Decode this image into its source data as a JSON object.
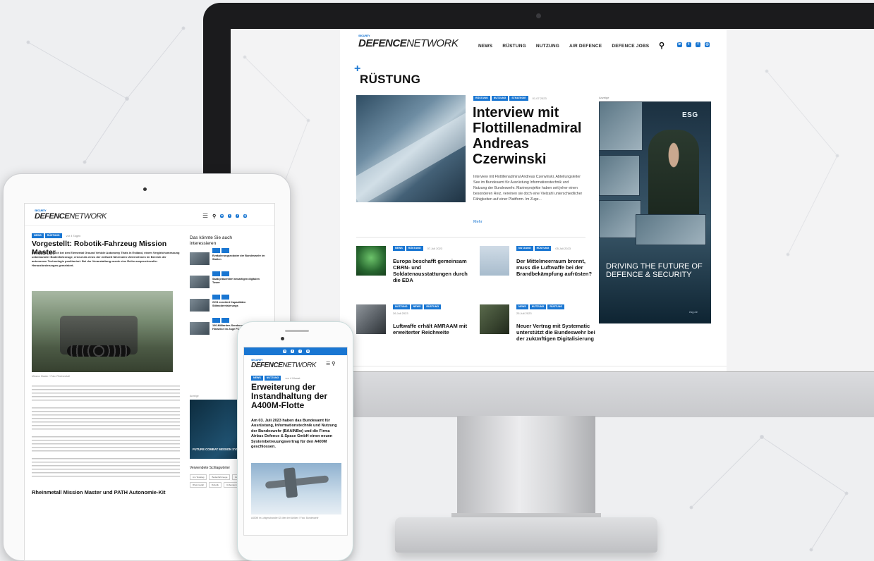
{
  "site": {
    "logo_bold": "DEFENCE",
    "logo_light": "NETWORK",
    "logo_sup": "SECURITY"
  },
  "desktop": {
    "nav": [
      "NEWS",
      "RÜSTUNG",
      "NUTZUNG",
      "AIR DEFENCE",
      "DEFENCE JOBS"
    ],
    "section": "RÜSTUNG",
    "hero": {
      "tags": [
        "RÜSTUNG",
        "NUTZUNG",
        "STRATEGIE"
      ],
      "date": "01.07.2023",
      "title": "Interview mit Flottillenadmiral Andreas Czerwinski",
      "excerpt": "Interview mit Flottillenadmiral Andreas Czerwinski, Abteilungsleiter See im Bundesamt für Ausrüstung Informationstechnik und Nutzung der Bundeswehr. Marineprojekte haben seit jeher einen besonderen Reiz, vereinen sie doch eine Vielzahl unterschiedlicher Fähigkeiten auf einer Plattform. Im Zuge...",
      "more": "Mehr"
    },
    "ad": {
      "label": "Anzeige",
      "brand": "ESG",
      "copy": "DRIVING THE FUTURE OF DEFENCE & SECURITY",
      "url": "esg.de"
    },
    "cards": [
      {
        "tags": [
          "NEWS",
          "RÜSTUNG"
        ],
        "date": "07.Juli 2023",
        "title": "Europa beschafft gemeinsam CBRN- und Soldatenausstattungen durch die EDA"
      },
      {
        "tags": [
          "NUTZUNG",
          "RÜSTUNG"
        ],
        "date": "05.Juli 2023",
        "title": "Der Mittelmeerraum brennt, muss die Luftwaffe bei der Brandbekämpfung aufrüsten?"
      },
      {
        "tags": [
          "NUTZUNG",
          "NEWS",
          "RÜSTUNG"
        ],
        "date": "26.Juli 2023",
        "title": "Luftwaffe erhält AMRAAM mit erweiterter Reichweite"
      },
      {
        "tags": [
          "NEWS",
          "NUTZUNG",
          "RÜSTUNG"
        ],
        "date": "25.Juli 2023",
        "title": "Neuer Vertrag mit Systematic unterstützt die Bundeswehr bei der zukünftigen Digitalisierung"
      }
    ]
  },
  "tablet": {
    "tags": [
      "NEWS",
      "RÜSTUNG"
    ],
    "date": "vor 4 Tagen",
    "title": "Vorgestellt: Robotik-Fahrzeug Mission Master",
    "lede": "Rheinmetall hat sich bei den Elemental Ground Vehicle Autonomy Trials in Estland, einem Vergleichsmessung unbemannter Bodenfahrzeuge, erneut als eines der weltweit führenden Unternehmen im Bereich der autonomen Technologie positioniert. Bei der Veranstaltung wurde eine Reihe anspruchsvoller Herausforderungen gemeistert.",
    "caption": "Mission Master / Foto: Rheinmetall",
    "h2": "Rheinmetall Mission Master und PATH Autonomie-Kit",
    "side_heading": "Das könnte Sie auch interessieren",
    "side_items": [
      "Evakuierungsroboter der Bundeswehr im Stollen",
      "Saab präsentiert neuartigen digitalen Tower",
      "GCS erweitert Kapazitäten Stilmodernisierungs",
      "100-Milliarden-Sondervermögen: Hinweise im Zuge FCAS"
    ],
    "ad_label": "Anzeige",
    "ad_text": "FUTURE COMBAT MISSION SYSTEM",
    "kw_heading": "Verwendete Schlagwörter",
    "keywords": [
      "Am Teststag",
      "Bodenfahrzeuge",
      "Estland",
      "Mission Master SP",
      "Rheinmetall",
      "Robotik",
      "Unbemannte Bodenfahrzeuge"
    ]
  },
  "phone": {
    "tags": [
      "NEWS",
      "NUTZUNG"
    ],
    "date": "vor 4 Monat",
    "title": "Erweiterung der Instandhaltung der A400M-Flotte",
    "lede": "Am 03. Juli 2023 haben das Bundesamt für Ausrüstung, Informationstechnik und Nutzung der Bundeswehr (BAAINBw) und die Firma Airbus Defence & Space GmbH einen neuen Systembetreuungsvertrag für den A400M geschlossen.",
    "caption": "A400M im Luftgeschwader 62 über den Wolken / Foto: Bundeswehr"
  },
  "colors": {
    "accent": "#1976d2",
    "imac_frame": "#1b1b1d"
  },
  "icons": [
    "search-icon",
    "linkedin-icon",
    "twitter-icon",
    "facebook-icon",
    "instagram-icon",
    "menu-icon"
  ]
}
